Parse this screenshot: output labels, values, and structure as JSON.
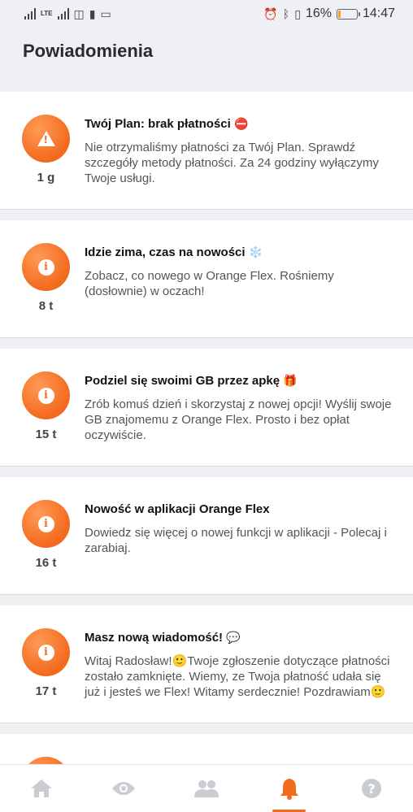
{
  "status_bar": {
    "lte_label": "LTE",
    "battery_percent": "16%",
    "battery_level": 0.16,
    "time": "14:47"
  },
  "header": {
    "title": "Powiadomienia"
  },
  "colors": {
    "accent": "#f26a1e",
    "nav_inactive": "#c9ccd1"
  },
  "notifications": [
    {
      "icon": "warning-icon",
      "age": "1 g",
      "title": "Twój Plan: brak płatności",
      "emoji": "⛔",
      "body": "Nie otrzymaliśmy płatności za Twój Plan. Sprawdź szczegóły metody płatności. Za 24 godziny wyłączymy Twoje usługi."
    },
    {
      "icon": "info-icon",
      "age": "8 t",
      "title": "Idzie zima, czas na nowości",
      "emoji": "❄️",
      "body": "Zobacz, co nowego w Orange Flex. Rośniemy (dosłownie) w oczach!"
    },
    {
      "icon": "info-icon",
      "age": "15 t",
      "title": "Podziel się swoimi GB przez apkę",
      "emoji": "🎁",
      "body": "Zrób komuś dzień i skorzystaj z nowej opcji! Wyślij swoje GB znajomemu z Orange Flex. Prosto i bez opłat oczywiście."
    },
    {
      "icon": "info-icon",
      "age": "16 t",
      "title": "Nowość w aplikacji Orange Flex",
      "emoji": "",
      "body": "Dowiedz się więcej o nowej funkcji w aplikacji - Polecaj i zarabiaj."
    },
    {
      "icon": "info-icon",
      "age": "17 t",
      "title": "Masz nową wiadomość!",
      "emoji": "💬",
      "body": "Witaj Radosław!🙂Twoje zgłoszenie dotyczące płatności zostało zamknięte. Wiemy, ze Twoja płatność udała się już i jesteś we Flex! Witamy serdecznie! Pozdrawiam🙂"
    }
  ],
  "bottom_nav": [
    {
      "icon": "home-icon",
      "active": false
    },
    {
      "icon": "eye-icon",
      "active": false
    },
    {
      "icon": "people-icon",
      "active": false
    },
    {
      "icon": "bell-icon",
      "active": true
    },
    {
      "icon": "help-icon",
      "active": false
    }
  ]
}
